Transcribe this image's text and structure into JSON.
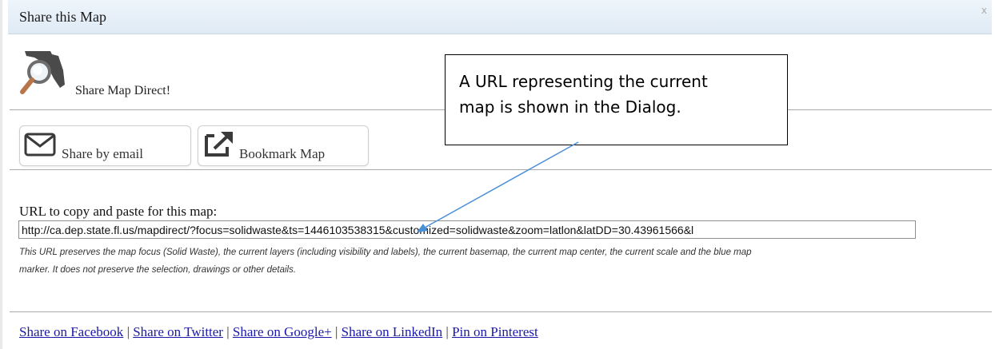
{
  "dialog": {
    "title": "Share this Map",
    "close": "x"
  },
  "header": {
    "text": "Share Map Direct!",
    "logo_icon": "florida-map-magnifier-icon"
  },
  "buttons": {
    "email": {
      "label": "Share by email",
      "icon": "envelope-icon"
    },
    "bookmark": {
      "label": "Bookmark Map",
      "icon": "external-link-icon"
    }
  },
  "url": {
    "label": "URL to copy and paste for this map:",
    "value": "http://ca.dep.state.fl.us/mapdirect/?focus=solidwaste&ts=1446103538315&customized=solidwaste&zoom=latlon&latDD=30.43961566&l"
  },
  "note": {
    "line1": "This URL preserves the map focus (Solid Waste), the current layers (including visibility and labels), the current basemap, the current map center, the current scale and the blue map",
    "line2": "marker. It does not preserve the selection, drawings or other details."
  },
  "share_links": {
    "facebook": "Share on Facebook",
    "twitter": "Share on Twitter",
    "google": "Share on Google+",
    "linkedin": "Share on LinkedIn",
    "pinterest": "Pin on Pinterest",
    "separator": " | "
  },
  "callout": {
    "line1": "A URL representing the current",
    "line2": "map is shown in the Dialog."
  },
  "colors": {
    "link": "#1a1aa8",
    "arrow": "#4a90d9",
    "titlebar": "#e6eef7"
  }
}
